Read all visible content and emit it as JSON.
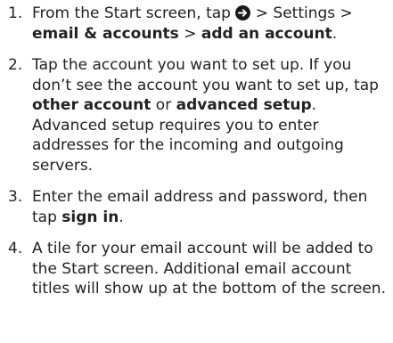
{
  "steps": [
    {
      "number": "1.",
      "segments": {
        "t1": "From the Start screen, tap ",
        "t2": " > Settings > ",
        "t3": "email & accounts",
        "t4": " > ",
        "t5": "add an account",
        "t6": "."
      }
    },
    {
      "number": "2.",
      "segments": {
        "t1": "Tap the account you want to set up. If you don’t see the account you want to set up, tap ",
        "t2": "other account",
        "t3": " or ",
        "t4": "advanced setup",
        "t5": ". Advanced setup requires you to enter addresses for the incoming and outgoing servers."
      }
    },
    {
      "number": "3.",
      "segments": {
        "t1": "Enter the email address and password, then tap ",
        "t2": "sign in",
        "t3": "."
      }
    },
    {
      "number": "4.",
      "segments": {
        "t1": "A tile for your email account will be added to the Start screen. Additional email account titles will show up at the bottom of the screen."
      }
    }
  ],
  "icons": {
    "arrow": "arrow-right-circle-icon"
  }
}
